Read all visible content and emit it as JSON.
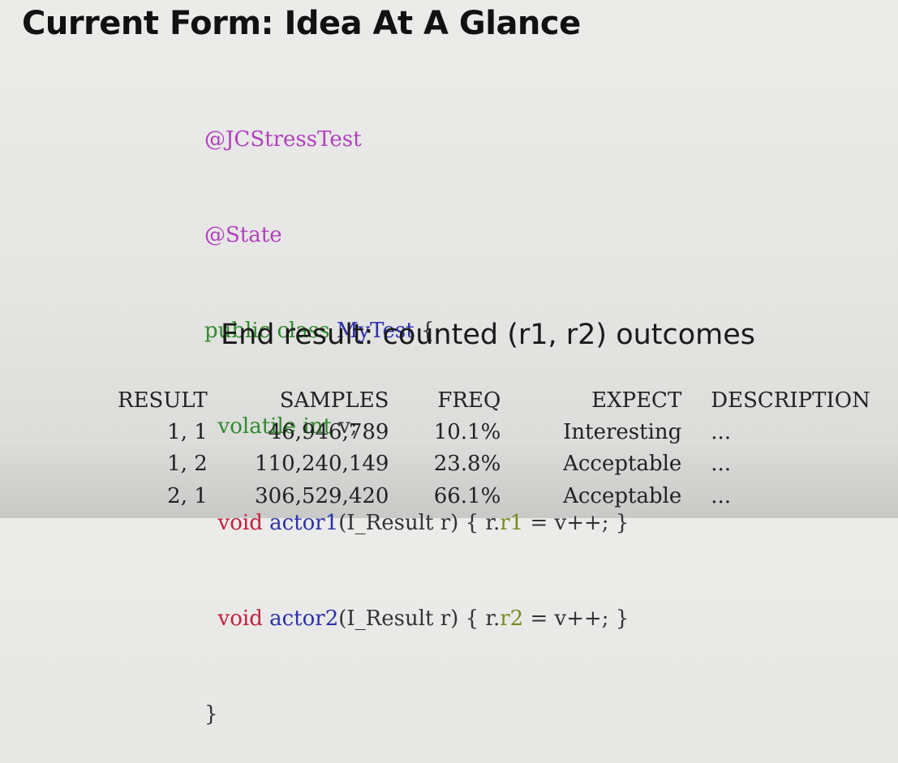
{
  "slide": {
    "title": "Current Form: Idea At A Glance",
    "subtitle": "End result: counted (r1, r2) outcomes"
  },
  "code": {
    "line1": "@JCStressTest",
    "line2": "@State",
    "line3": {
      "kw": "public class",
      "name": "MyTest",
      "rest": " {"
    },
    "line4": {
      "indent": "  ",
      "kw": "volatile int",
      "rest": " v;"
    },
    "line5": {
      "indent": "  ",
      "kw": "void",
      "name": "actor1",
      "pre": "(I_Result r) { r.",
      "field": "r1",
      "post": " = v++; }"
    },
    "line6": {
      "indent": "  ",
      "kw": "void",
      "name": "actor2",
      "pre": "(I_Result r) { r.",
      "field": "r2",
      "post": " = v++; }"
    },
    "line7": "}"
  },
  "table": {
    "headers": {
      "result": "RESULT",
      "samples": "SAMPLES",
      "freq": "FREQ",
      "expect": "EXPECT",
      "description": "DESCRIPTION"
    },
    "rows": [
      {
        "result": "1, 1",
        "samples": "46,946,789",
        "freq": "10.1%",
        "expect": "Interesting",
        "description": "..."
      },
      {
        "result": "1, 2",
        "samples": "110,240,149",
        "freq": "23.8%",
        "expect": "Acceptable",
        "description": "..."
      },
      {
        "result": "2, 1",
        "samples": "306,529,420",
        "freq": "66.1%",
        "expect": "Acceptable",
        "description": "..."
      }
    ]
  },
  "colors": {
    "annotation": "#b13fbf",
    "keyword_green": "#2f8a2c",
    "keyword_red": "#c0203f",
    "identifier_blue": "#2b2fae",
    "field_olive": "#7a8a1f"
  }
}
